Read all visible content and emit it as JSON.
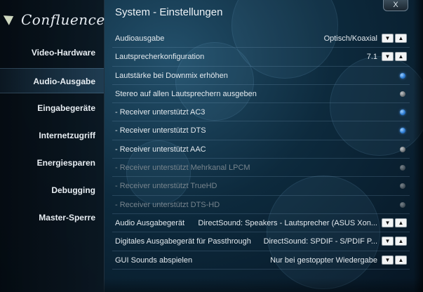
{
  "logo": {
    "text": "Confluence"
  },
  "window": {
    "title": "System - Einstellungen",
    "close_label": "X"
  },
  "sidebar": {
    "items": [
      {
        "label": "Video-Hardware",
        "active": false
      },
      {
        "label": "Audio-Ausgabe",
        "active": true
      },
      {
        "label": "Eingabegeräte",
        "active": false
      },
      {
        "label": "Internetzugriff",
        "active": false
      },
      {
        "label": "Energiesparen",
        "active": false
      },
      {
        "label": "Debugging",
        "active": false
      },
      {
        "label": "Master-Sperre",
        "active": false
      }
    ]
  },
  "settings": [
    {
      "label": "Audioausgabe",
      "value": "Optisch/Koaxial",
      "control": "spinner",
      "enabled": true
    },
    {
      "label": "Lautsprecherkonfiguration",
      "value": "7.1",
      "control": "spinner",
      "enabled": true
    },
    {
      "label": "Lautstärke bei Downmix erhöhen",
      "control": "radio",
      "checked": true,
      "enabled": true
    },
    {
      "label": "Stereo auf allen Lautsprechern ausgeben",
      "control": "radio",
      "checked": false,
      "enabled": true
    },
    {
      "label": "- Receiver unterstützt AC3",
      "control": "radio",
      "checked": true,
      "enabled": true
    },
    {
      "label": "- Receiver unterstützt DTS",
      "control": "radio",
      "checked": true,
      "enabled": true
    },
    {
      "label": "- Receiver unterstützt AAC",
      "control": "radio",
      "checked": false,
      "enabled": true
    },
    {
      "label": "- Receiver unterstützt Mehrkanal LPCM",
      "control": "radio",
      "checked": false,
      "enabled": false
    },
    {
      "label": "- Receiver unterstützt TrueHD",
      "control": "radio",
      "checked": false,
      "enabled": false
    },
    {
      "label": "- Receiver unterstützt DTS-HD",
      "control": "radio",
      "checked": false,
      "enabled": false
    },
    {
      "label": "Audio Ausgabegerät",
      "value": "DirectSound: Speakers - Lautsprecher (ASUS Xon...",
      "control": "spinner",
      "enabled": true,
      "wide": true
    },
    {
      "label": "Digitales Ausgabegerät für Passthrough",
      "value": "DirectSound: SPDIF - S/PDIF P...",
      "control": "spinner",
      "enabled": true,
      "wide": true
    },
    {
      "label": "GUI Sounds abspielen",
      "value": "Nur bei gestoppter Wiedergabe",
      "control": "spinner",
      "enabled": true
    }
  ],
  "icons": {
    "spinner_down": "▼",
    "spinner_up": "▲"
  },
  "colors": {
    "radio_on": "#2f7fd6",
    "radio_off": "#6c7276",
    "disabled_text": "#77848d"
  }
}
